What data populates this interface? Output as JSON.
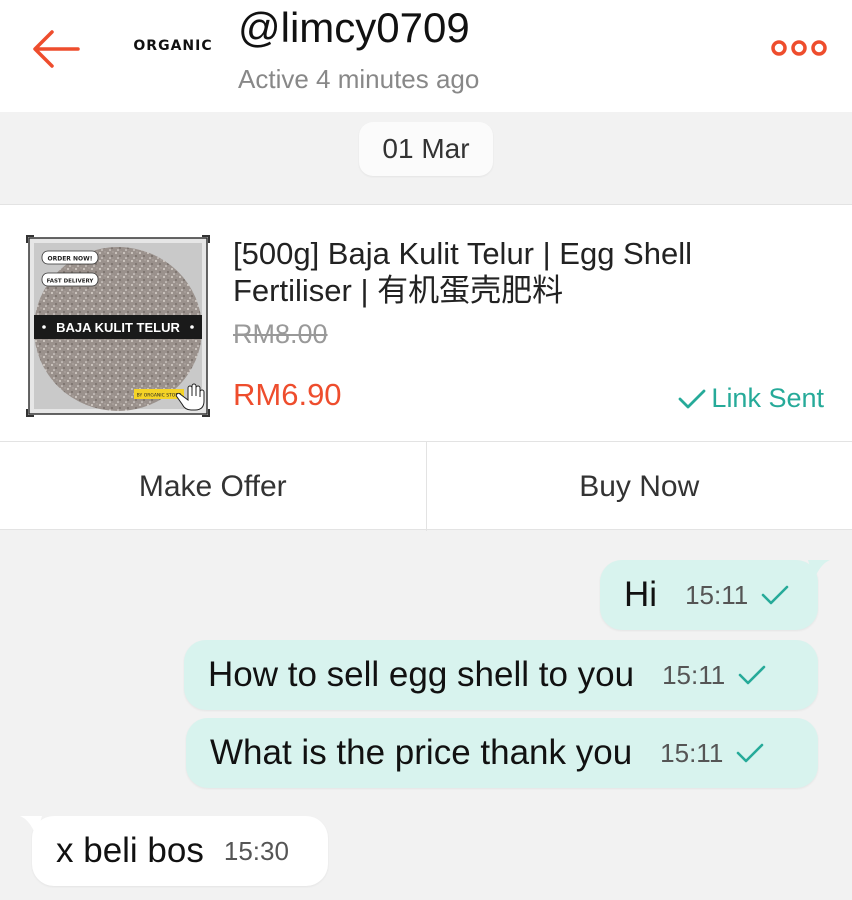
{
  "header": {
    "back_icon": "arrow-left-icon",
    "shop_logo_text": "ORGANIC",
    "username": "@limcy0709",
    "status": "Active 4 minutes ago",
    "more_icon": "more-dots-icon"
  },
  "date_separator": "01 Mar",
  "product": {
    "title": "[500g] Baja Kulit Telur | Egg Shell Fertiliser | 有机蛋壳肥料",
    "original_price": "RM8.00",
    "price": "RM6.90",
    "link_status": "Link Sent",
    "image_text": {
      "order_now": "ORDER NOW!",
      "fast_delivery": "FAST DELIVERY",
      "banner": "BAJA KULIT TELUR",
      "store": "BY ORGANIC STORE"
    },
    "actions": {
      "make_offer": "Make Offer",
      "buy_now": "Buy Now"
    }
  },
  "messages": [
    {
      "direction": "out",
      "text": "Hi",
      "time": "15:11"
    },
    {
      "direction": "out",
      "text": "How to sell egg shell to you",
      "time": "15:11"
    },
    {
      "direction": "out",
      "text": "What is the price thank you",
      "time": "15:11"
    },
    {
      "direction": "in",
      "text": "x beli bos",
      "time": "15:30"
    }
  ],
  "colors": {
    "accent": "#ee4d2d",
    "teal": "#26aa99",
    "outgoing_bubble": "#d8f3ee",
    "incoming_bubble": "#ffffff",
    "background": "#f2f2f2"
  }
}
